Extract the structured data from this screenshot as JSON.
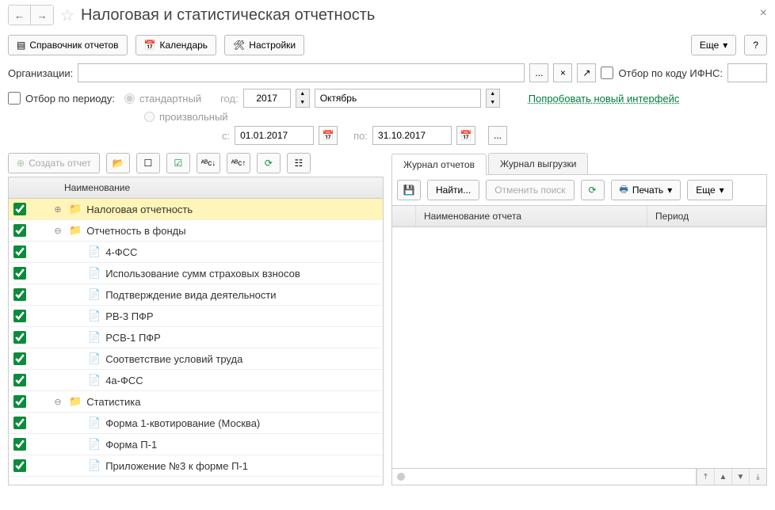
{
  "header": {
    "title": "Налоговая и статистическая отчетность"
  },
  "toolbar": {
    "reports_guide": "Справочник отчетов",
    "calendar": "Календарь",
    "settings": "Настройки",
    "more": "Еще",
    "help": "?"
  },
  "filters": {
    "org_label": "Организации:",
    "ifns_label": "Отбор по коду ИФНС:",
    "period_label": "Отбор по периоду:",
    "standard": "стандартный",
    "custom": "произвольный",
    "year_label": "год:",
    "year_value": "2017",
    "month_value": "Октябрь",
    "from_label": "с:",
    "from_value": "01.01.2017",
    "to_label": "по:",
    "to_value": "31.10.2017",
    "ellipsis": "...",
    "try_new": "Попробовать новый интерфейс"
  },
  "left_toolbar": {
    "create": "Создать отчет"
  },
  "tree": {
    "header": "Наименование",
    "rows": [
      {
        "label": "Налоговая отчетность",
        "level": 0,
        "type": "folder",
        "exp": "plus",
        "selected": true
      },
      {
        "label": "Отчетность в фонды",
        "level": 0,
        "type": "folder",
        "exp": "minus"
      },
      {
        "label": "4-ФСС",
        "level": 1,
        "type": "doc"
      },
      {
        "label": "Использование сумм страховых взносов",
        "level": 1,
        "type": "doc"
      },
      {
        "label": "Подтверждение вида деятельности",
        "level": 1,
        "type": "doc"
      },
      {
        "label": "РВ-3 ПФР",
        "level": 1,
        "type": "doc"
      },
      {
        "label": "РСВ-1 ПФР",
        "level": 1,
        "type": "doc"
      },
      {
        "label": "Соответствие условий труда",
        "level": 1,
        "type": "doc"
      },
      {
        "label": "4а-ФСС",
        "level": 1,
        "type": "doc"
      },
      {
        "label": "Статистика",
        "level": 0,
        "type": "folder",
        "exp": "minus"
      },
      {
        "label": "Форма 1-квотирование (Москва)",
        "level": 1,
        "type": "doc"
      },
      {
        "label": "Форма П-1",
        "level": 1,
        "type": "doc"
      },
      {
        "label": "Приложение №3 к форме П-1",
        "level": 1,
        "type": "doc"
      }
    ]
  },
  "right": {
    "tab1": "Журнал отчетов",
    "tab2": "Журнал выгрузки",
    "find": "Найти...",
    "cancel_find": "Отменить поиск",
    "print": "Печать",
    "more": "Еще",
    "col_name": "Наименование отчета",
    "col_period": "Период"
  }
}
